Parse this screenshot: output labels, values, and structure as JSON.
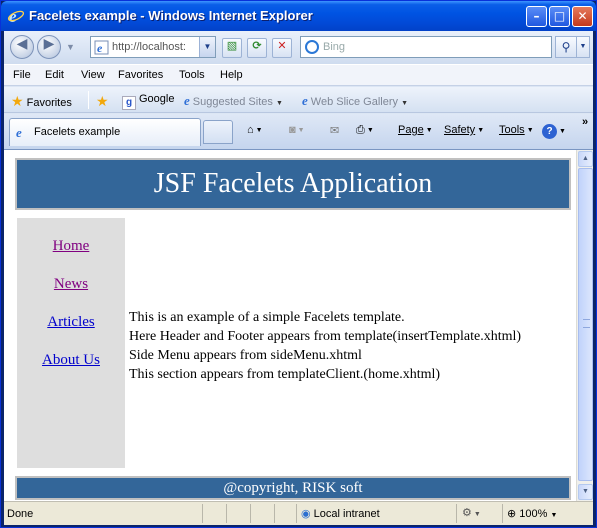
{
  "window": {
    "title": "Facelets example - Windows Internet Explorer",
    "min_glyph": "–",
    "max_glyph": "□",
    "close_glyph": "✕"
  },
  "nav": {
    "address": "http://localhost:",
    "search_placeholder": "Bing"
  },
  "menu": [
    "File",
    "Edit",
    "View",
    "Favorites",
    "Tools",
    "Help"
  ],
  "favorites": {
    "label": "Favorites",
    "items": [
      "Google",
      "Suggested Sites",
      "Web Slice Gallery"
    ]
  },
  "tab": {
    "title": "Facelets example"
  },
  "commands": {
    "page": "Page",
    "safety": "Safety",
    "tools": "Tools"
  },
  "page": {
    "header": "JSF Facelets Application",
    "menu": [
      "Home",
      "News",
      "Articles",
      "About Us"
    ],
    "lines": [
      "This is an example of a simple Facelets template.",
      "Here Header and Footer appears from template(insertTemplate.xhtml)",
      "Side Menu appears from sideMenu.xhtml",
      "This section appears from templateClient.(home.xhtml)"
    ],
    "footer": "@copyright, RISK soft"
  },
  "status": {
    "text": "Done",
    "zone": "Local intranet",
    "zoom": "100%"
  },
  "colors": {
    "header_bg": "#336699",
    "sidebar_bg": "#dedede",
    "visited_link": "#800080",
    "link": "#0000cc"
  }
}
